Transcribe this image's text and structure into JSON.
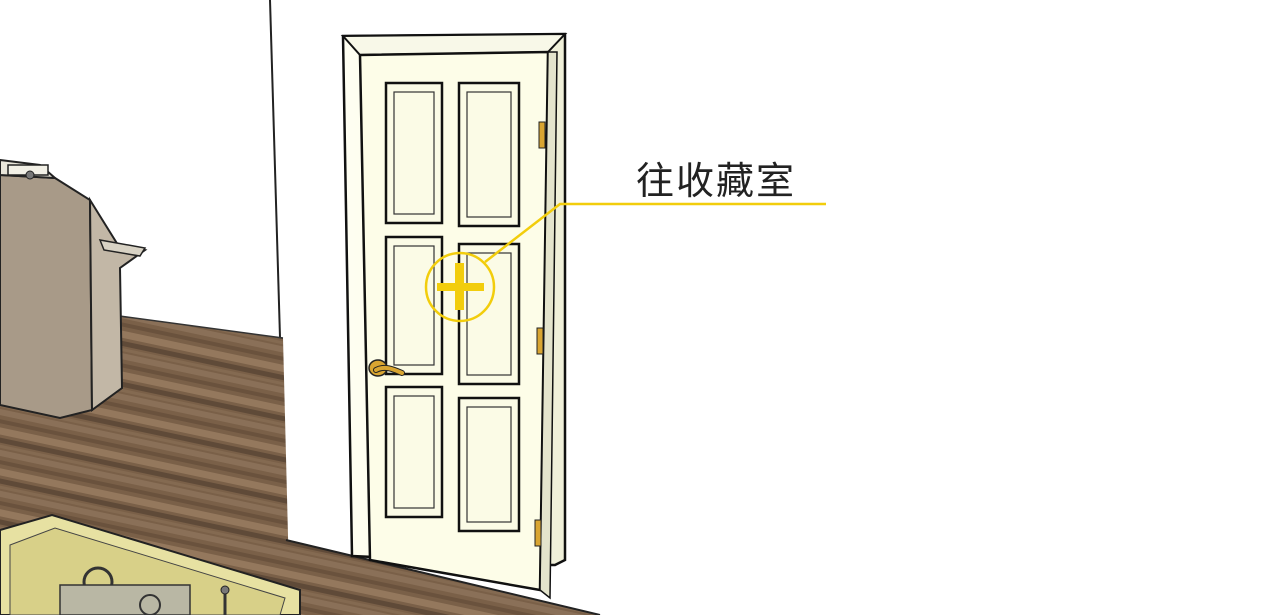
{
  "hotspot": {
    "label": "往收藏室",
    "accent_color": "#f2cd0c"
  },
  "scene": {
    "icons": [
      "door-hotspot-plus-icon",
      "door-handle",
      "cabinet",
      "display-case"
    ]
  }
}
